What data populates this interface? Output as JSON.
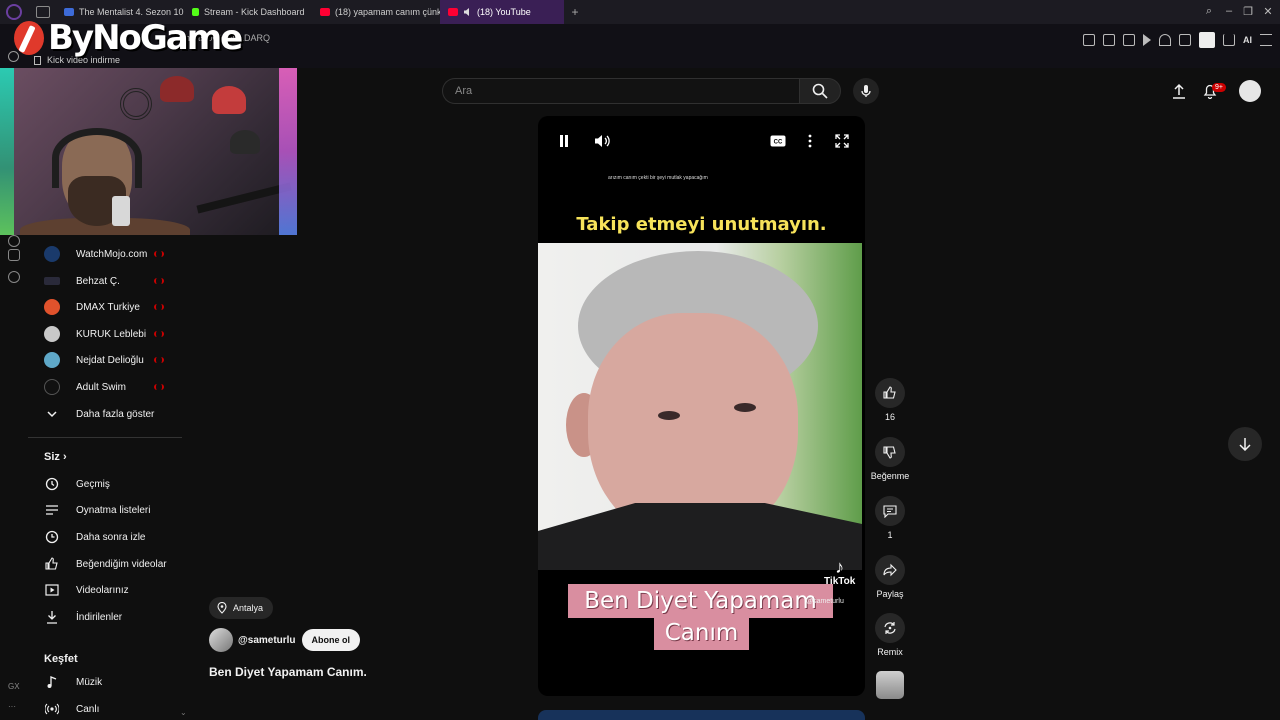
{
  "browser": {
    "tabs": [
      {
        "label": "The Mentalist 4. Sezon 10.",
        "color": "#3d6bd8"
      },
      {
        "label": "Stream - Kick Dashboard",
        "color": "#53fc18"
      },
      {
        "label": "(18) yapamam canım çünk",
        "color": "#ff0033"
      },
      {
        "label": "(18) YouTube",
        "color": "#ff0033"
      }
    ],
    "url": "/shorts/0OVjw_LDARQ",
    "download_hint": "Kick video indirme",
    "ext_ai_label": "AI"
  },
  "overlay": {
    "brand": "ByNoGame"
  },
  "mini_rail": {
    "gx_label": "GX",
    "more_label": "···"
  },
  "sidebar": {
    "subscriptions": [
      {
        "label": "WatchMojo.com",
        "avatar_color": "#1a3a6b"
      },
      {
        "label": "Behzat Ç.",
        "avatar_color": "#2a2a3a"
      },
      {
        "label": "DMAX Turkiye",
        "avatar_color": "#e0522c"
      },
      {
        "label": "KURUK Leblebi",
        "avatar_color": "#c8c8c8"
      },
      {
        "label": "Nejdat Delioğlu",
        "avatar_color": "#5fa8c8"
      },
      {
        "label": "Adult Swim",
        "avatar_color": "#111111"
      }
    ],
    "show_more": "Daha fazla göster",
    "you_heading": "Siz",
    "you_items": [
      {
        "label": "Geçmiş",
        "icon": "history-icon"
      },
      {
        "label": "Oynatma listeleri",
        "icon": "playlists-icon"
      },
      {
        "label": "Daha sonra izle",
        "icon": "watch-later-icon"
      },
      {
        "label": "Beğendiğim videolar",
        "icon": "liked-icon"
      },
      {
        "label": "Videolarınız",
        "icon": "your-videos-icon"
      },
      {
        "label": "İndirilenler",
        "icon": "downloads-icon"
      }
    ],
    "explore_heading": "Keşfet",
    "explore_items": [
      {
        "label": "Müzik",
        "icon": "music-icon"
      },
      {
        "label": "Canlı",
        "icon": "live-icon"
      }
    ]
  },
  "search": {
    "placeholder": "Ara"
  },
  "header": {
    "notifications_badge": "9+"
  },
  "short": {
    "small_caption": "arızım canım çekti bir şeyi mutlak yapacağım",
    "headline": "Takip etmeyi unutmayın.",
    "subtitle_line1": "Ben Diyet Yapamam",
    "subtitle_line2": "Canım",
    "watermark": "TikTok",
    "watermark_handle": "@sameturlu",
    "location": "Antalya",
    "channel_handle": "@sameturlu",
    "subscribe_label": "Abone ol",
    "title": "Ben Diyet Yapamam Canım."
  },
  "actions": {
    "like_count": "16",
    "dislike_label": "Beğenme",
    "comment_count": "1",
    "share_label": "Paylaş",
    "remix_label": "Remix"
  },
  "colors": {
    "youtube_red": "#ff0033",
    "headline_yellow": "#f7e35a",
    "subtitle_bg": "#d98ea0"
  }
}
